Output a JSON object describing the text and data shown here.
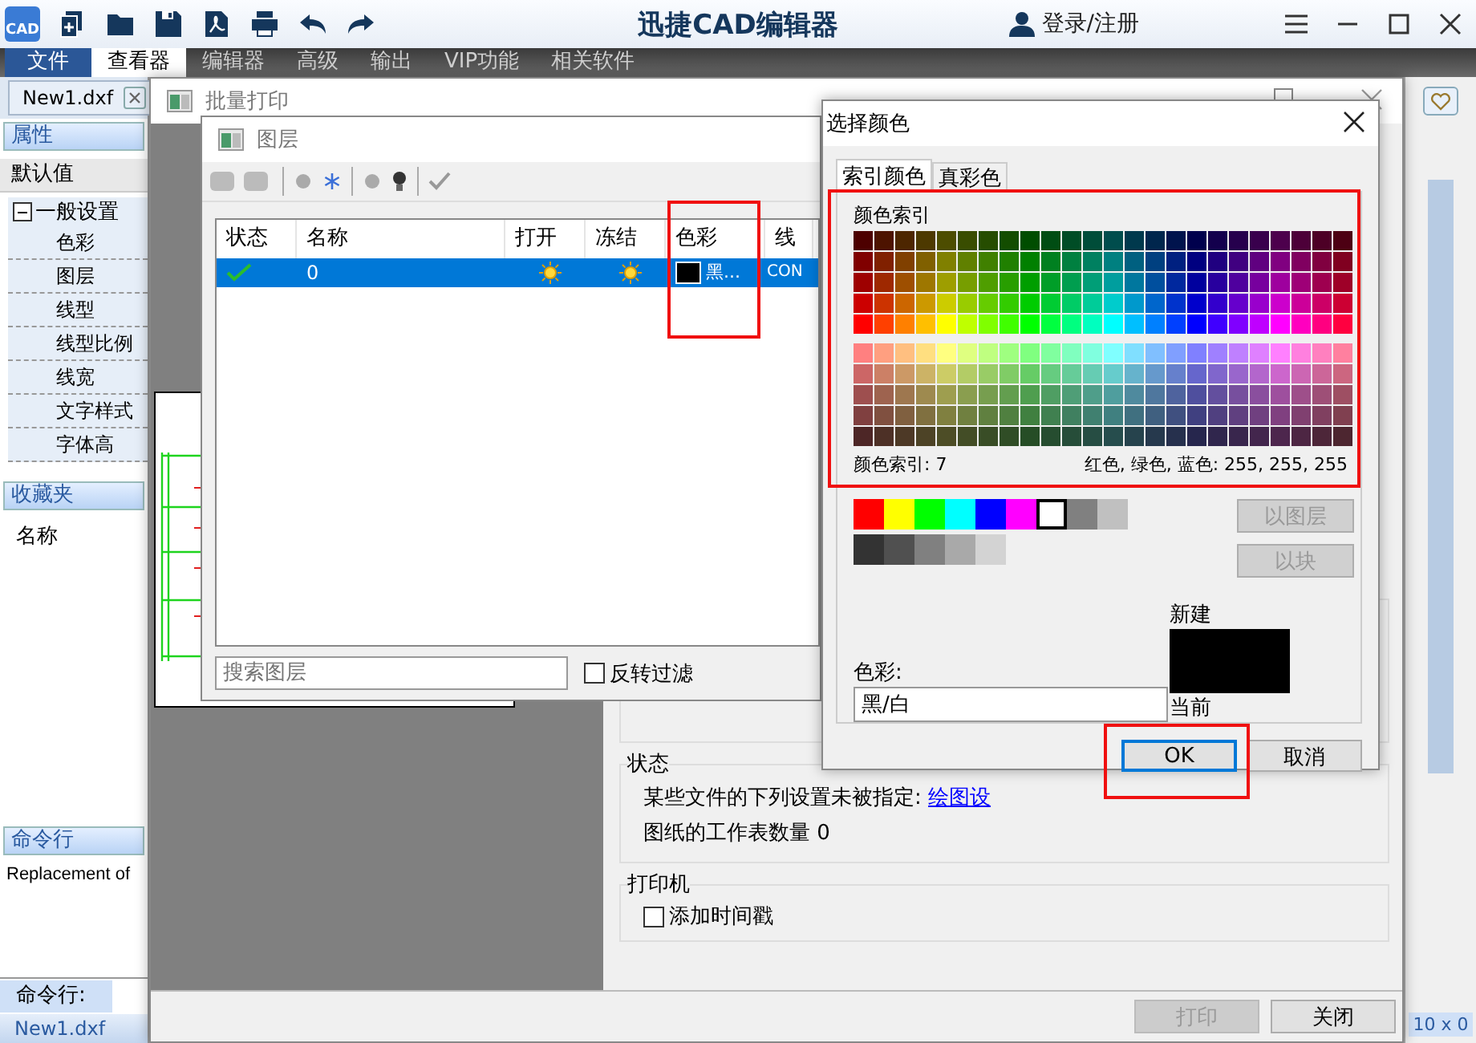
{
  "logo": "CAD",
  "app_title": "迅捷CAD编辑器",
  "login": "登录/注册",
  "menu_tabs": [
    {
      "label": "文件",
      "kind": "file",
      "selected": false
    },
    {
      "label": "查看器",
      "kind": "tab",
      "selected": true
    },
    {
      "label": "编辑器",
      "kind": "tab",
      "selected": false
    },
    {
      "label": "高级",
      "kind": "tab",
      "selected": false
    },
    {
      "label": "输出",
      "kind": "tab",
      "selected": false
    },
    {
      "label": "VIP功能",
      "kind": "tab",
      "selected": false
    },
    {
      "label": "相关软件",
      "kind": "tab",
      "selected": false
    }
  ],
  "doc_tab": "New1.dxf",
  "properties": {
    "title": "属性",
    "default_label": "默认值",
    "group": {
      "label": "一般设置",
      "expanded": true,
      "children": [
        "色彩",
        "图层",
        "线型",
        "线型比例",
        "线宽",
        "文字样式",
        "字体高"
      ]
    }
  },
  "favorites": {
    "title": "收藏夹",
    "column": "名称"
  },
  "command": {
    "title": "命令行",
    "output": "Replacement of",
    "prompt_label": "命令行:"
  },
  "status_bar": {
    "file": "New1.dxf",
    "coords": "10 x 0"
  },
  "batch_print": {
    "title": "批量打印",
    "status": {
      "title": "状态",
      "message": "某些文件的下列设置未被指定:",
      "link": "绘图设",
      "sheets": "图纸的工作表数量 0"
    },
    "printer": {
      "title": "打印机",
      "timestamp": {
        "label": "添加时间戳",
        "checked": false
      }
    },
    "buttons": [
      {
        "label": "打印",
        "disabled": true
      },
      {
        "label": "关闭",
        "disabled": false
      }
    ]
  },
  "layers": {
    "title": "图层",
    "columns": [
      "状态",
      "名称",
      "打开",
      "冻结",
      "色彩",
      "线"
    ],
    "rows": [
      {
        "current": true,
        "name": "0",
        "on": true,
        "frozen": false,
        "color_name": "黑...",
        "color": "#000000",
        "linetype": "CON",
        "selected": true
      }
    ],
    "search_placeholder": "搜索图层",
    "invert_filter": {
      "label": "反转过滤",
      "checked": false
    }
  },
  "color_dialog": {
    "title": "选择颜色",
    "tabs": [
      {
        "label": "索引颜色",
        "selected": true
      },
      {
        "label": "真彩色",
        "selected": false
      }
    ],
    "palette_label": "颜色索引",
    "index_readout": "颜色索引: 7",
    "rgb_readout": "红色, 绿色, 蓝色: 255, 255, 255",
    "standard_colors": [
      {
        "color": "#ff0000",
        "selected": false
      },
      {
        "color": "#ffff00",
        "selected": false
      },
      {
        "color": "#00ff00",
        "selected": false
      },
      {
        "color": "#00ffff",
        "selected": false
      },
      {
        "color": "#0000ff",
        "selected": false
      },
      {
        "color": "#ff00ff",
        "selected": false
      },
      {
        "color": "#ffffff",
        "selected": true
      },
      {
        "color": "#808080",
        "selected": false
      },
      {
        "color": "#c0c0c0",
        "selected": false
      }
    ],
    "gray_colors": [
      {
        "color": "#333333",
        "selected": false
      },
      {
        "color": "#505050",
        "selected": false
      },
      {
        "color": "#808080",
        "selected": false
      },
      {
        "color": "#a9a9a9",
        "selected": false
      },
      {
        "color": "#d3d3d3",
        "selected": false
      }
    ],
    "side_buttons": [
      {
        "label": "以图层",
        "disabled": true
      },
      {
        "label": "以块",
        "disabled": true
      }
    ],
    "color_label": "色彩:",
    "color_value": "黑/白",
    "new_label": "新建",
    "current_label": "当前",
    "buttons": [
      {
        "label": "OK",
        "default": true
      },
      {
        "label": "取消",
        "default": false
      }
    ]
  }
}
